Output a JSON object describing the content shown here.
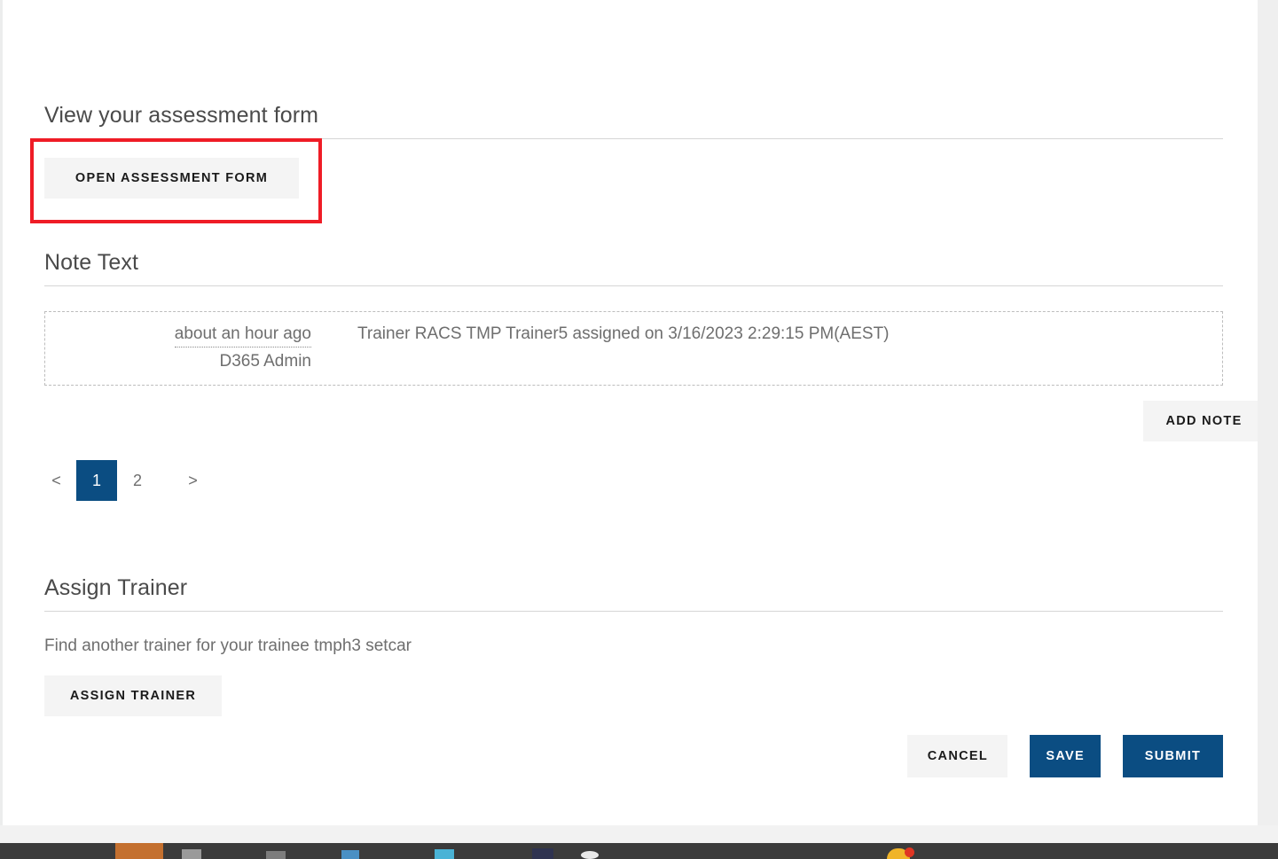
{
  "sections": {
    "view_form": {
      "heading": "View your assessment form",
      "open_form_button": "OPEN ASSESSMENT FORM"
    },
    "note_text": {
      "heading": "Note Text",
      "notes": [
        {
          "time": "about an hour ago",
          "author": "D365 Admin",
          "body": "Trainer RACS TMP Trainer5 assigned on 3/16/2023 2:29:15 PM(AEST)"
        }
      ],
      "add_note_button": "ADD NOTE",
      "pagination": {
        "prev": "<",
        "next": ">",
        "pages": [
          "1",
          "2"
        ],
        "active_page": "1"
      }
    },
    "assign_trainer": {
      "heading": "Assign Trainer",
      "description": "Find another trainer for your trainee tmph3 setcar",
      "assign_button": "ASSIGN TRAINER"
    }
  },
  "footer": {
    "cancel_label": "CANCEL",
    "save_label": "SAVE",
    "submit_label": "SUBMIT"
  },
  "colors": {
    "primary_blue": "#0b4d82",
    "highlight_red": "#ef1c26",
    "button_light": "#f4f4f4",
    "text_gray": "#6e6e6e"
  }
}
